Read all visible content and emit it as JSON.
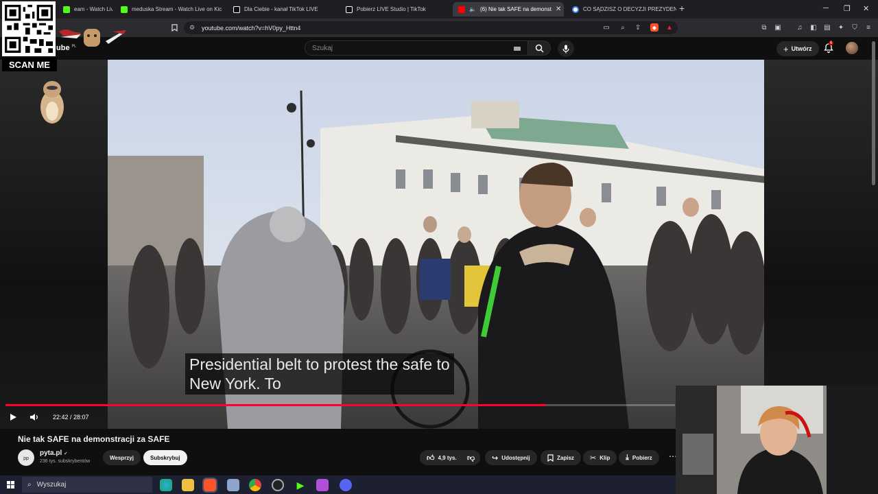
{
  "browser": {
    "tabs": [
      {
        "label": "eam - Watch Live on",
        "color": "#53fc18",
        "active": false
      },
      {
        "label": "meduska Stream - Watch Live on Kic",
        "color": "#53fc18",
        "active": false
      },
      {
        "label": "Dla Ciebie - kanał TikTok LIVE",
        "color": "#ffffff",
        "active": false
      },
      {
        "label": "Pobierz LIVE Studio | TikTok",
        "color": "#ffffff",
        "active": false
      },
      {
        "label": "(6) Nie tak SAFE na demonst",
        "color": "#ff0000",
        "active": true
      },
      {
        "label": "CO SĄDZISZ O DECYZJI PREZYDENTA",
        "color": "#4285f4",
        "active": false
      }
    ],
    "url": "youtube.com/watch?v=hV0py_Httn4"
  },
  "youtube": {
    "logo_text": "ube",
    "logo_region": "PL",
    "search_placeholder": "Szukaj",
    "create_label": "Utwórz",
    "notification_count": "6"
  },
  "overlay": {
    "scan_label": "SCAN ME"
  },
  "player": {
    "caption_line1": "Presidential belt to protest the safe to",
    "caption_line2": "New York.  To",
    "time_display": "22:42 / 28:07",
    "progress_fraction": 0.8075
  },
  "video_info": {
    "title": "Nie tak SAFE na demonstracji za SAFE",
    "channel_name": "pyta.pl",
    "channel_subs": "236 tys. subskrybentów",
    "support_label": "Wesprzyj",
    "subscribe_label": "Subskrybuj",
    "like_count": "4,9 tys.",
    "share_label": "Udostępnij",
    "save_label": "Zapisz",
    "clip_label": "Klip",
    "download_label": "Pobierz"
  },
  "taskbar": {
    "search_placeholder": "Wyszukaj"
  },
  "colors": {
    "accent": "#ff0033",
    "bg": "#0f0f0f"
  }
}
